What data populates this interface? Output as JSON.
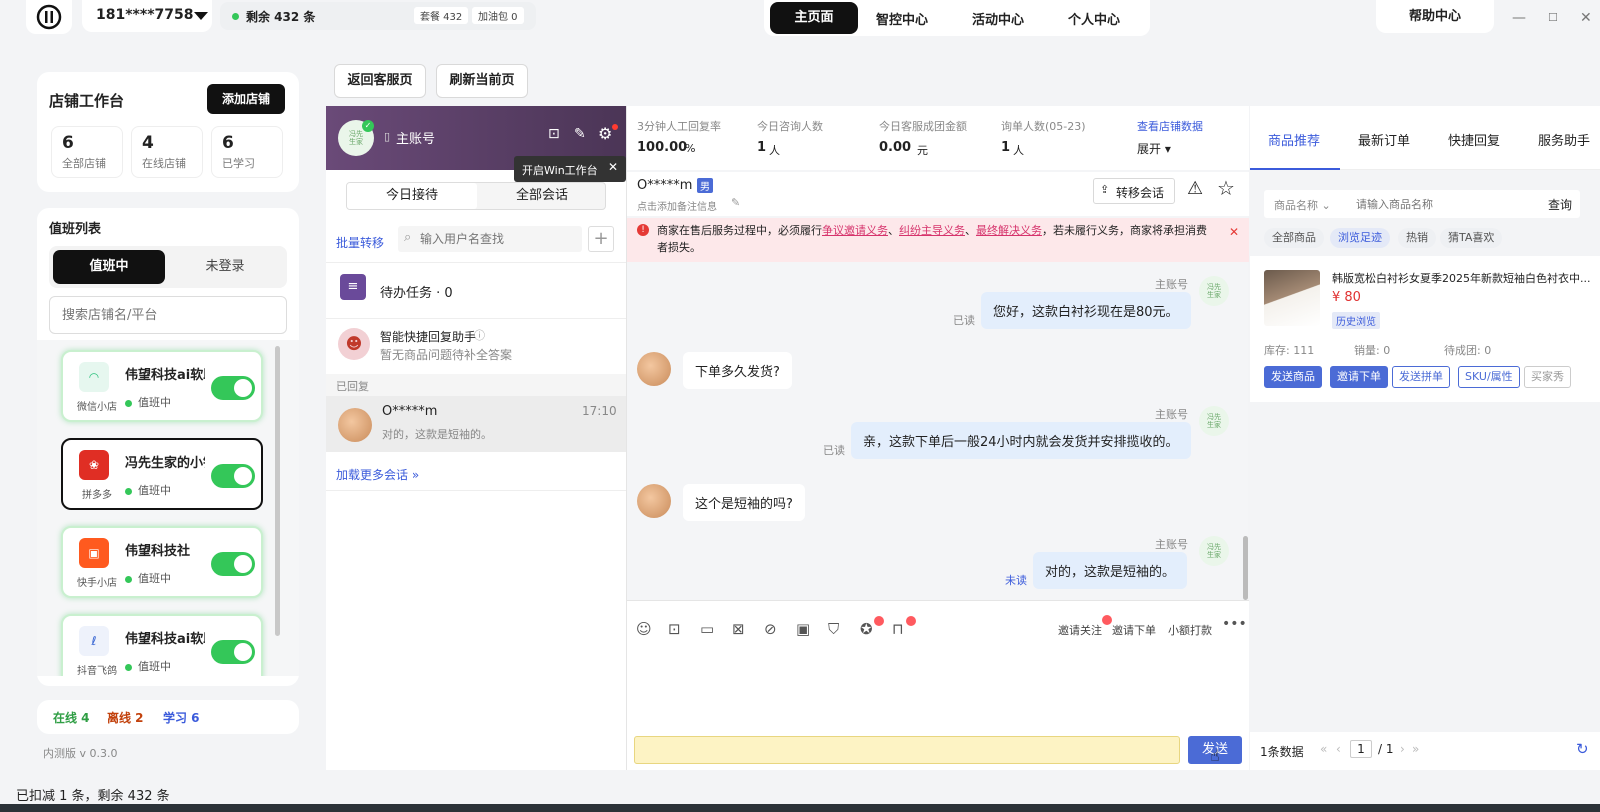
{
  "topbar": {
    "phone": "181****7758",
    "remaining": "剩余 432 条",
    "package": "套餐 432",
    "fuel": "加油包 0",
    "nav": [
      "主页面",
      "智控中心",
      "活动中心",
      "个人中心"
    ],
    "help": "帮助中心"
  },
  "sidebar": {
    "title": "店铺工作台",
    "add_button": "添加店铺",
    "stats": [
      {
        "num": "6",
        "label": "全部店铺"
      },
      {
        "num": "4",
        "label": "在线店铺"
      },
      {
        "num": "6",
        "label": "已学习"
      }
    ],
    "duty_title": "值班列表",
    "duty_tabs": [
      "值班中",
      "未登录"
    ],
    "search_placeholder": "搜索店铺名/平台",
    "shops": [
      {
        "name": "伟望科技ai软助",
        "platform": "微信小店",
        "status": "值班中",
        "color": "#2ec27e"
      },
      {
        "name": "冯先生家的小铺",
        "platform": "拼多多",
        "status": "值班中",
        "color": "#e02e24"
      },
      {
        "name": "伟望科技社",
        "platform": "快手小店",
        "status": "值班中",
        "color": "#ff5a1f"
      },
      {
        "name": "伟望科技ai软助",
        "platform": "抖音飞鸽",
        "status": "值班中",
        "color": "#2f5fd0"
      }
    ],
    "summary": {
      "online": "在线 4",
      "offline": "离线 2",
      "learn": "学习 6"
    },
    "version": "内测版 v 0.3.0"
  },
  "toolbar": {
    "back": "返回客服页",
    "refresh": "刷新当前页"
  },
  "session": {
    "account": "主账号",
    "tooltip": "开启Win工作台",
    "tabs": [
      "今日接待",
      "全部会话"
    ],
    "batch": "批量转移",
    "search_placeholder": "输入用户名查找",
    "todo": "待办任务 · 0",
    "assistant_title": "智能快捷回复助手",
    "assistant_sub": "暂无商品问题待补全答案",
    "replied_label": "已回复",
    "conv_name": "O*****m",
    "conv_time": "17:10",
    "conv_preview": "对的，这款是短袖的。",
    "load_more": "加载更多会话 »"
  },
  "metrics": [
    {
      "label": "3分钟人工回复率",
      "value": "100.00",
      "unit": "%"
    },
    {
      "label": "今日咨询人数",
      "value": "1",
      "unit": "人"
    },
    {
      "label": "今日客服成团金额",
      "value": "0.00",
      "unit": "元"
    },
    {
      "label": "询单人数(05-23)",
      "value": "1",
      "unit": "人"
    }
  ],
  "metrics_link": "查看店铺数据",
  "metrics_expand": "展开",
  "chat": {
    "customer": "O*****m",
    "gender": "男",
    "note": "点击添加备注信息",
    "transfer": "转移会话",
    "notice_pre": "商家在售后服务过程中，必须履行",
    "notice_l1": "争议邀请义务",
    "notice_l2": "纠纷主导义务",
    "notice_l3": "最终解决义务",
    "notice_post": "，若未履行义务，商家将承担消费者损失。",
    "sender": "主账号",
    "msg1": "您好，这款白衬衫现在是80元。",
    "read1": "已读",
    "msg2": "下单多久发货?",
    "msg3": "亲，这款下单后一般24小时内就会发货并安排揽收的。",
    "read3": "已读",
    "msg4": "这个是短袖的吗?",
    "msg5": "对的，这款是短袖的。",
    "read5": "未读",
    "tools_right": [
      "邀请关注",
      "邀请下单",
      "小额打款"
    ],
    "send": "发送"
  },
  "right": {
    "tabs": [
      "商品推荐",
      "最新订单",
      "快捷回复",
      "服务助手"
    ],
    "filter": "商品名称",
    "search_placeholder": "请输入商品名称",
    "query": "查询",
    "tags": [
      "全部商品",
      "浏览足迹",
      "热销",
      "猜TA喜欢"
    ],
    "product_title": "韩版宽松白衬衫女夏季2025年新款短袖白色衬衣中...",
    "price": "¥ 80",
    "history": "历史浏览",
    "stock": "库存: 111",
    "sales": "销量: 0",
    "group": "待成团: 0",
    "buttons": [
      "发送商品",
      "邀请下单",
      "发送拼单",
      "SKU/属性",
      "买家秀"
    ],
    "count": "1条数据",
    "page": "1",
    "total": "/ 1"
  },
  "statusbar": "已扣减 1 条，剩余 432 条"
}
